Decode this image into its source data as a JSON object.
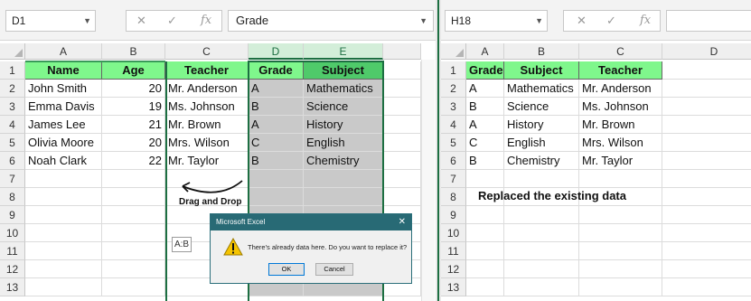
{
  "left": {
    "name_box": "D1",
    "formula": "Grade",
    "fx_label": "fx",
    "cancel_glyph": "✕",
    "enter_glyph": "✓",
    "columns": [
      "A",
      "B",
      "C",
      "D",
      "E"
    ],
    "rows": [
      "1",
      "2",
      "3",
      "4",
      "5",
      "6",
      "7",
      "8",
      "9",
      "10",
      "11",
      "12",
      "13"
    ],
    "header": [
      "Name",
      "Age",
      "Teacher",
      "Grade",
      "Subject"
    ],
    "data": [
      [
        "John Smith",
        "20",
        "Mr. Anderson",
        "A",
        "Mathematics"
      ],
      [
        "Emma Davis",
        "19",
        "Ms. Johnson",
        "B",
        "Science"
      ],
      [
        "James Lee",
        "21",
        "Mr. Brown",
        "A",
        "History"
      ],
      [
        "Olivia Moore",
        "20",
        "Mrs. Wilson",
        "C",
        "English"
      ],
      [
        "Noah Clark",
        "22",
        "Mr. Taylor",
        "B",
        "Chemistry"
      ]
    ],
    "drag_label": "Drag and Drop",
    "paste_tip": "A:B"
  },
  "dialog": {
    "title": "Microsoft Excel",
    "close": "✕",
    "message": "There's already data here. Do you want to replace it?",
    "ok": "OK",
    "cancel": "Cancel",
    "icon": "warning-icon"
  },
  "right": {
    "name_box": "H18",
    "formula": "",
    "fx_label": "fx",
    "cancel_glyph": "✕",
    "enter_glyph": "✓",
    "columns": [
      "A",
      "B",
      "C",
      "D"
    ],
    "rows": [
      "1",
      "2",
      "3",
      "4",
      "5",
      "6",
      "7",
      "8",
      "9",
      "10",
      "11",
      "12",
      "13"
    ],
    "header": [
      "Grade",
      "Subject",
      "Teacher"
    ],
    "data": [
      [
        "A",
        "Mathematics",
        "Mr. Anderson"
      ],
      [
        "B",
        "Science",
        "Ms. Johnson"
      ],
      [
        "A",
        "History",
        "Mr. Brown"
      ],
      [
        "C",
        "English",
        "Mrs. Wilson"
      ],
      [
        "B",
        "Chemistry",
        "Mr. Taylor"
      ]
    ],
    "annotation": "Replaced the existing data"
  },
  "colors": {
    "header_fill": "#7ff78c",
    "accent": "#1d6f42",
    "selection": "#c9c9c9",
    "dialog_title": "#286a75"
  }
}
